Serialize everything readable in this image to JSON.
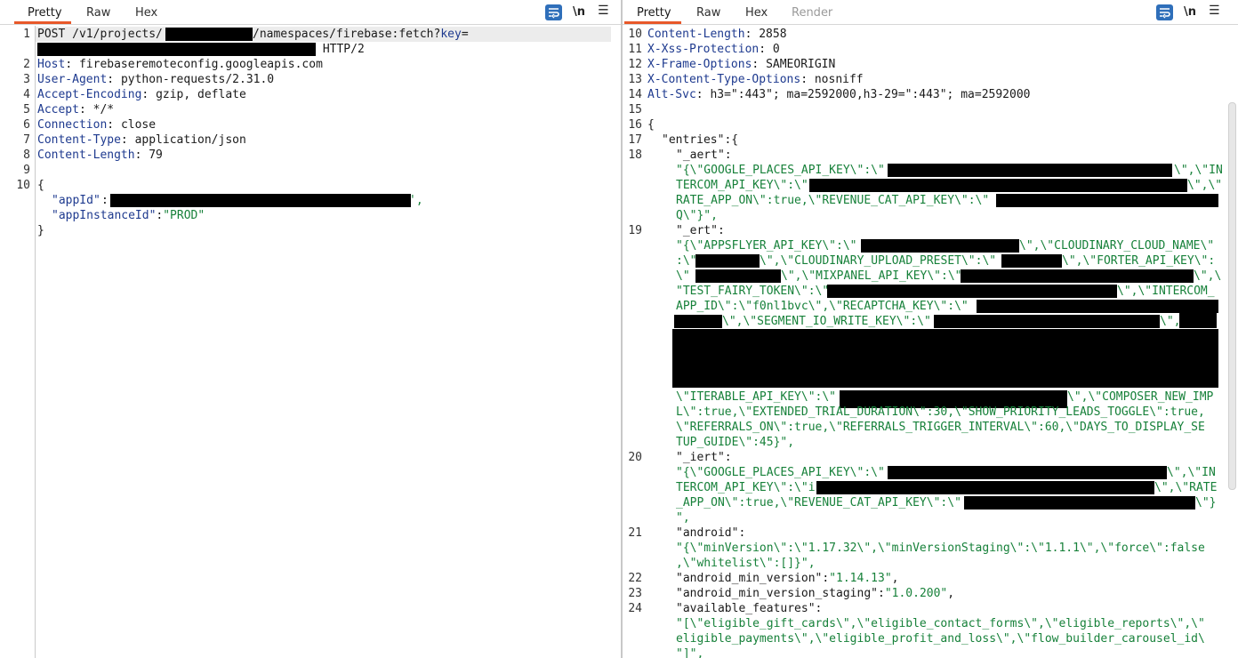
{
  "request": {
    "tabs": [
      "Pretty",
      "Raw",
      "Hex"
    ],
    "newline_label": "\\n",
    "line_numbers": [
      "1",
      "2",
      "3",
      "4",
      "5",
      "6",
      "7",
      "8",
      "9",
      "10"
    ],
    "request_line": {
      "method_path": "POST /v1/projects/",
      "mid": "/namespaces/firebase:fetch?",
      "key_param": "key",
      "eq": "=",
      "proto": " HTTP/2"
    },
    "headers": [
      {
        "name": "Host",
        "value": "firebaseremoteconfig.googleapis.com"
      },
      {
        "name": "User-Agent",
        "value": "python-requests/2.31.0"
      },
      {
        "name": "Accept-Encoding",
        "value": "gzip, deflate"
      },
      {
        "name": "Accept",
        "value": "*/*"
      },
      {
        "name": "Connection",
        "value": "close"
      },
      {
        "name": "Content-Type",
        "value": "application/json"
      },
      {
        "name": "Content-Length",
        "value": "79"
      }
    ],
    "body": {
      "open": "{",
      "app_id_key": "\"appId\"",
      "app_id_tail": "',",
      "instance_key": "\"appInstanceId\"",
      "instance_value": "\"PROD\"",
      "close": "}"
    }
  },
  "response": {
    "tabs": [
      "Pretty",
      "Raw",
      "Hex",
      "Render"
    ],
    "newline_label": "\\n",
    "headers": [
      {
        "num": "10",
        "name": "Content-Length",
        "value": "2858"
      },
      {
        "num": "11",
        "name": "X-Xss-Protection",
        "value": "0"
      },
      {
        "num": "12",
        "name": "X-Frame-Options",
        "value": "SAMEORIGIN"
      },
      {
        "num": "13",
        "name": "X-Content-Type-Options",
        "value": "nosniff"
      },
      {
        "num": "14",
        "name": "Alt-Svc",
        "value": "h3=\":443\"; ma=2592000,h3-29=\":443\"; ma=2592000"
      }
    ],
    "line_numbers": [
      "15",
      "16",
      "17",
      "18",
      "19",
      "20",
      "21",
      "22",
      "23",
      "24"
    ],
    "body_lines": {
      "l16": "{",
      "l17_key": "\"entries\"",
      "l17_tail": ":{",
      "aert_key": "\"_aert\"",
      "aert_1": "\"{\\\"GOOGLE_PLACES_API_KEY\\\":\\\"",
      "aert_1b": "\\\",\\\"IN",
      "aert_2": "TERCOM_API_KEY\\\":\\\"",
      "aert_2b": "\\\",\\\"",
      "aert_3": "RATE_APP_ON\\\":true,\\\"REVENUE_CAT_API_KEY\\\":\\\"",
      "aert_4": "Q\\\"}\",",
      "ert_key": "\"_ert\"",
      "ert_1": "\"{\\\"APPSFLYER_API_KEY\\\":\\\"",
      "ert_1b": "\\\",\\\"CLOUDINARY_CLOUD_NAME\\\"",
      "ert_2": ":\\\"",
      "ert_2b": "\\\",\\\"CLOUDINARY_UPLOAD_PRESET\\\":\\\"",
      "ert_2c": "\\\",\\\"FORTER_API_KEY\\\":",
      "ert_3": "\\\"",
      "ert_3b": "\\\",\\\"MIXPANEL_API_KEY\\\":\\\"",
      "ert_3c": "\\\",\\",
      "ert_4": "\"TEST_FAIRY_TOKEN\\\":\\\"",
      "ert_4b": "\\\",\\\"INTERCOM_",
      "ert_5": "APP_ID\\\":\\\"f0nl1bvc\\\",\\\"RECAPTCHA_KEY\\\":\\\"",
      "ert_6b": "\\\",\\\"SEGMENT_IO_WRITE_KEY\\\":\\\"",
      "ert_6c": "\\\",",
      "ert_10": "\\\"ITERABLE_API_KEY\\\":\\\"",
      "ert_10b": "\\\",\\\"COMPOSER_NEW_IMP",
      "ert_11": "L\\\":true,\\\"EXTENDED_TRIAL_DURATION\\\":30,\\\"SHOW_PRIORITY_LEADS_TOGGLE\\\":true,",
      "ert_12": "\\\"REFERRALS_ON\\\":true,\\\"REFERRALS_TRIGGER_INTERVAL\\\":60,\\\"DAYS_TO_DISPLAY_SE",
      "ert_13": "TUP_GUIDE\\\":45}\",",
      "iert_key": "\"_iert\"",
      "iert_1": "\"{\\\"GOOGLE_PLACES_API_KEY\\\":\\\"",
      "iert_1b": "\\\",\\\"IN",
      "iert_2": "TERCOM_API_KEY\\\":\\\"i",
      "iert_2b": "\\\",\\\"RATE",
      "iert_3": "_APP_ON\\\":true,\\\"REVENUE_CAT_API_KEY\\\":\\\"",
      "iert_3b": "\\\"}",
      "iert_4": "\",",
      "android_key": "\"android\"",
      "android_1": "\"{\\\"minVersion\\\":\\\"1.17.32\\\",\\\"minVersionStaging\\\":\\\"1.1.1\\\",\\\"force\\\":false",
      "android_2": ",\\\"whitelist\\\":[]}\",",
      "amv_key": "\"android_min_version\"",
      "amv_value": "\"1.14.13\"",
      "amvs_key": "\"android_min_version_staging\"",
      "amvs_value": "\"1.0.200\"",
      "af_key": "\"available_features\"",
      "af_1": "\"[\\\"eligible_gift_cards\\\",\\\"eligible_contact_forms\\\",\\\"eligible_reports\\\",\\\"",
      "af_2": "eligible_payments\\\",\\\"eligible_profit_and_loss\\\",\\\"flow_builder_carousel_id\\",
      "af_3": "\"]\","
    }
  }
}
